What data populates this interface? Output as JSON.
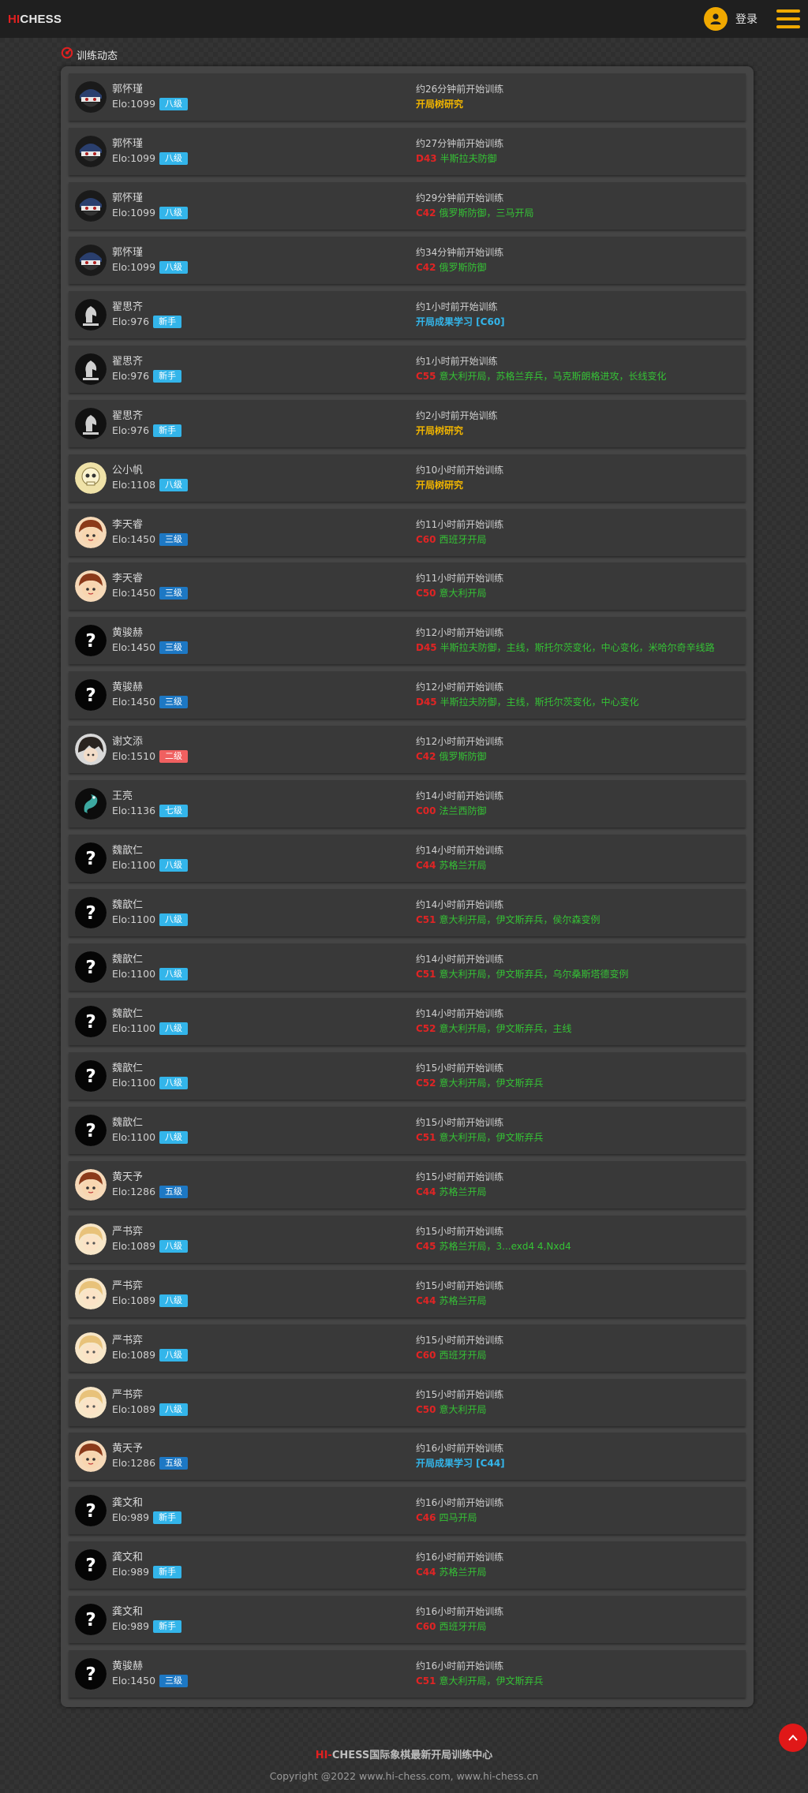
{
  "header": {
    "logo_hi": "HI",
    "logo_rest": "CHESS",
    "login_label": "登录"
  },
  "section": {
    "title": "训练动态"
  },
  "badge_colors": {
    "八级": "#33b5ea",
    "新手": "#33b5ea",
    "三级": "#1d78c4",
    "二级": "#f06060",
    "七级": "#33b5ea",
    "五级": "#1d78c4"
  },
  "activities": [
    {
      "name": "郭怀瑾",
      "elo": "Elo:1099",
      "badge": "八级",
      "avatar": "mask",
      "time": "约26分钟前开始训练",
      "kind": "yellow",
      "text": "开局树研究"
    },
    {
      "name": "郭怀瑾",
      "elo": "Elo:1099",
      "badge": "八级",
      "avatar": "mask",
      "time": "约27分钟前开始训练",
      "kind": "eco",
      "code": "D43",
      "opening": "半斯拉夫防御"
    },
    {
      "name": "郭怀瑾",
      "elo": "Elo:1099",
      "badge": "八级",
      "avatar": "mask",
      "time": "约29分钟前开始训练",
      "kind": "eco",
      "code": "C42",
      "opening": "俄罗斯防御，三马开局"
    },
    {
      "name": "郭怀瑾",
      "elo": "Elo:1099",
      "badge": "八级",
      "avatar": "mask",
      "time": "约34分钟前开始训练",
      "kind": "eco",
      "code": "C42",
      "opening": "俄罗斯防御"
    },
    {
      "name": "翟思齐",
      "elo": "Elo:976",
      "badge": "新手",
      "avatar": "knight",
      "time": "约1小时前开始训练",
      "kind": "blue",
      "text": "开局成果学习 [C60]"
    },
    {
      "name": "翟思齐",
      "elo": "Elo:976",
      "badge": "新手",
      "avatar": "knight",
      "time": "约1小时前开始训练",
      "kind": "eco",
      "code": "C55",
      "opening": "意大利开局，苏格兰弃兵，马克斯朗格进攻，长线变化"
    },
    {
      "name": "翟思齐",
      "elo": "Elo:976",
      "badge": "新手",
      "avatar": "knight",
      "time": "约2小时前开始训练",
      "kind": "yellow",
      "text": "开局树研究"
    },
    {
      "name": "公小帆",
      "elo": "Elo:1108",
      "badge": "八级",
      "avatar": "skull",
      "time": "约10小时前开始训练",
      "kind": "yellow",
      "text": "开局树研究"
    },
    {
      "name": "李天睿",
      "elo": "Elo:1450",
      "badge": "三级",
      "avatar": "boy",
      "time": "约11小时前开始训练",
      "kind": "eco",
      "code": "C60",
      "opening": "西班牙开局"
    },
    {
      "name": "李天睿",
      "elo": "Elo:1450",
      "badge": "三级",
      "avatar": "boy",
      "time": "约11小时前开始训练",
      "kind": "eco",
      "code": "C50",
      "opening": "意大利开局"
    },
    {
      "name": "黄骏赫",
      "elo": "Elo:1450",
      "badge": "三级",
      "avatar": "question",
      "time": "约12小时前开始训练",
      "kind": "eco",
      "code": "D45",
      "opening": "半斯拉夫防御，主线，斯托尔茨变化，中心变化，米哈尔奇辛线路"
    },
    {
      "name": "黄骏赫",
      "elo": "Elo:1450",
      "badge": "三级",
      "avatar": "question",
      "time": "约12小时前开始训练",
      "kind": "eco",
      "code": "D45",
      "opening": "半斯拉夫防御，主线，斯托尔茨变化，中心变化"
    },
    {
      "name": "谢文添",
      "elo": "Elo:1510",
      "badge": "二级",
      "avatar": "anime",
      "time": "约12小时前开始训练",
      "kind": "eco",
      "code": "C42",
      "opening": "俄罗斯防御"
    },
    {
      "name": "王亮",
      "elo": "Elo:1136",
      "badge": "七级",
      "avatar": "snake",
      "time": "约14小时前开始训练",
      "kind": "eco",
      "code": "C00",
      "opening": "法兰西防御"
    },
    {
      "name": "魏歆仁",
      "elo": "Elo:1100",
      "badge": "八级",
      "avatar": "question",
      "time": "约14小时前开始训练",
      "kind": "eco",
      "code": "C44",
      "opening": "苏格兰开局"
    },
    {
      "name": "魏歆仁",
      "elo": "Elo:1100",
      "badge": "八级",
      "avatar": "question",
      "time": "约14小时前开始训练",
      "kind": "eco",
      "code": "C51",
      "opening": "意大利开局，伊文斯弃兵，侯尔森变例"
    },
    {
      "name": "魏歆仁",
      "elo": "Elo:1100",
      "badge": "八级",
      "avatar": "question",
      "time": "约14小时前开始训练",
      "kind": "eco",
      "code": "C51",
      "opening": "意大利开局，伊文斯弃兵，乌尔桑斯塔德变例"
    },
    {
      "name": "魏歆仁",
      "elo": "Elo:1100",
      "badge": "八级",
      "avatar": "question",
      "time": "约14小时前开始训练",
      "kind": "eco",
      "code": "C52",
      "opening": "意大利开局，伊文斯弃兵，主线"
    },
    {
      "name": "魏歆仁",
      "elo": "Elo:1100",
      "badge": "八级",
      "avatar": "question",
      "time": "约15小时前开始训练",
      "kind": "eco",
      "code": "C52",
      "opening": "意大利开局，伊文斯弃兵"
    },
    {
      "name": "魏歆仁",
      "elo": "Elo:1100",
      "badge": "八级",
      "avatar": "question",
      "time": "约15小时前开始训练",
      "kind": "eco",
      "code": "C51",
      "opening": "意大利开局，伊文斯弃兵"
    },
    {
      "name": "黄天予",
      "elo": "Elo:1286",
      "badge": "五级",
      "avatar": "boy",
      "time": "约15小时前开始训练",
      "kind": "eco",
      "code": "C44",
      "opening": "苏格兰开局"
    },
    {
      "name": "严书弈",
      "elo": "Elo:1089",
      "badge": "八级",
      "avatar": "blond",
      "time": "约15小时前开始训练",
      "kind": "eco",
      "code": "C45",
      "opening": "苏格兰开局，3...exd4 4.Nxd4"
    },
    {
      "name": "严书弈",
      "elo": "Elo:1089",
      "badge": "八级",
      "avatar": "blond",
      "time": "约15小时前开始训练",
      "kind": "eco",
      "code": "C44",
      "opening": "苏格兰开局"
    },
    {
      "name": "严书弈",
      "elo": "Elo:1089",
      "badge": "八级",
      "avatar": "blond",
      "time": "约15小时前开始训练",
      "kind": "eco",
      "code": "C60",
      "opening": "西班牙开局"
    },
    {
      "name": "严书弈",
      "elo": "Elo:1089",
      "badge": "八级",
      "avatar": "blond",
      "time": "约15小时前开始训练",
      "kind": "eco",
      "code": "C50",
      "opening": "意大利开局"
    },
    {
      "name": "黄天予",
      "elo": "Elo:1286",
      "badge": "五级",
      "avatar": "boy",
      "time": "约16小时前开始训练",
      "kind": "blue",
      "text": "开局成果学习 [C44]"
    },
    {
      "name": "龚文和",
      "elo": "Elo:989",
      "badge": "新手",
      "avatar": "question",
      "time": "约16小时前开始训练",
      "kind": "eco",
      "code": "C46",
      "opening": "四马开局"
    },
    {
      "name": "龚文和",
      "elo": "Elo:989",
      "badge": "新手",
      "avatar": "question",
      "time": "约16小时前开始训练",
      "kind": "eco",
      "code": "C44",
      "opening": "苏格兰开局"
    },
    {
      "name": "龚文和",
      "elo": "Elo:989",
      "badge": "新手",
      "avatar": "question",
      "time": "约16小时前开始训练",
      "kind": "eco",
      "code": "C60",
      "opening": "西班牙开局"
    },
    {
      "name": "黄骏赫",
      "elo": "Elo:1450",
      "badge": "三级",
      "avatar": "question",
      "time": "约16小时前开始训练",
      "kind": "eco",
      "code": "C51",
      "opening": "意大利开局，伊文斯弃兵"
    }
  ],
  "footer": {
    "brand_hi": "HI-",
    "brand_rest": "CHESS国际象棋最新开局训练中心",
    "copyright": "Copyright @2022 www.hi-chess.com, www.hi-chess.cn"
  }
}
